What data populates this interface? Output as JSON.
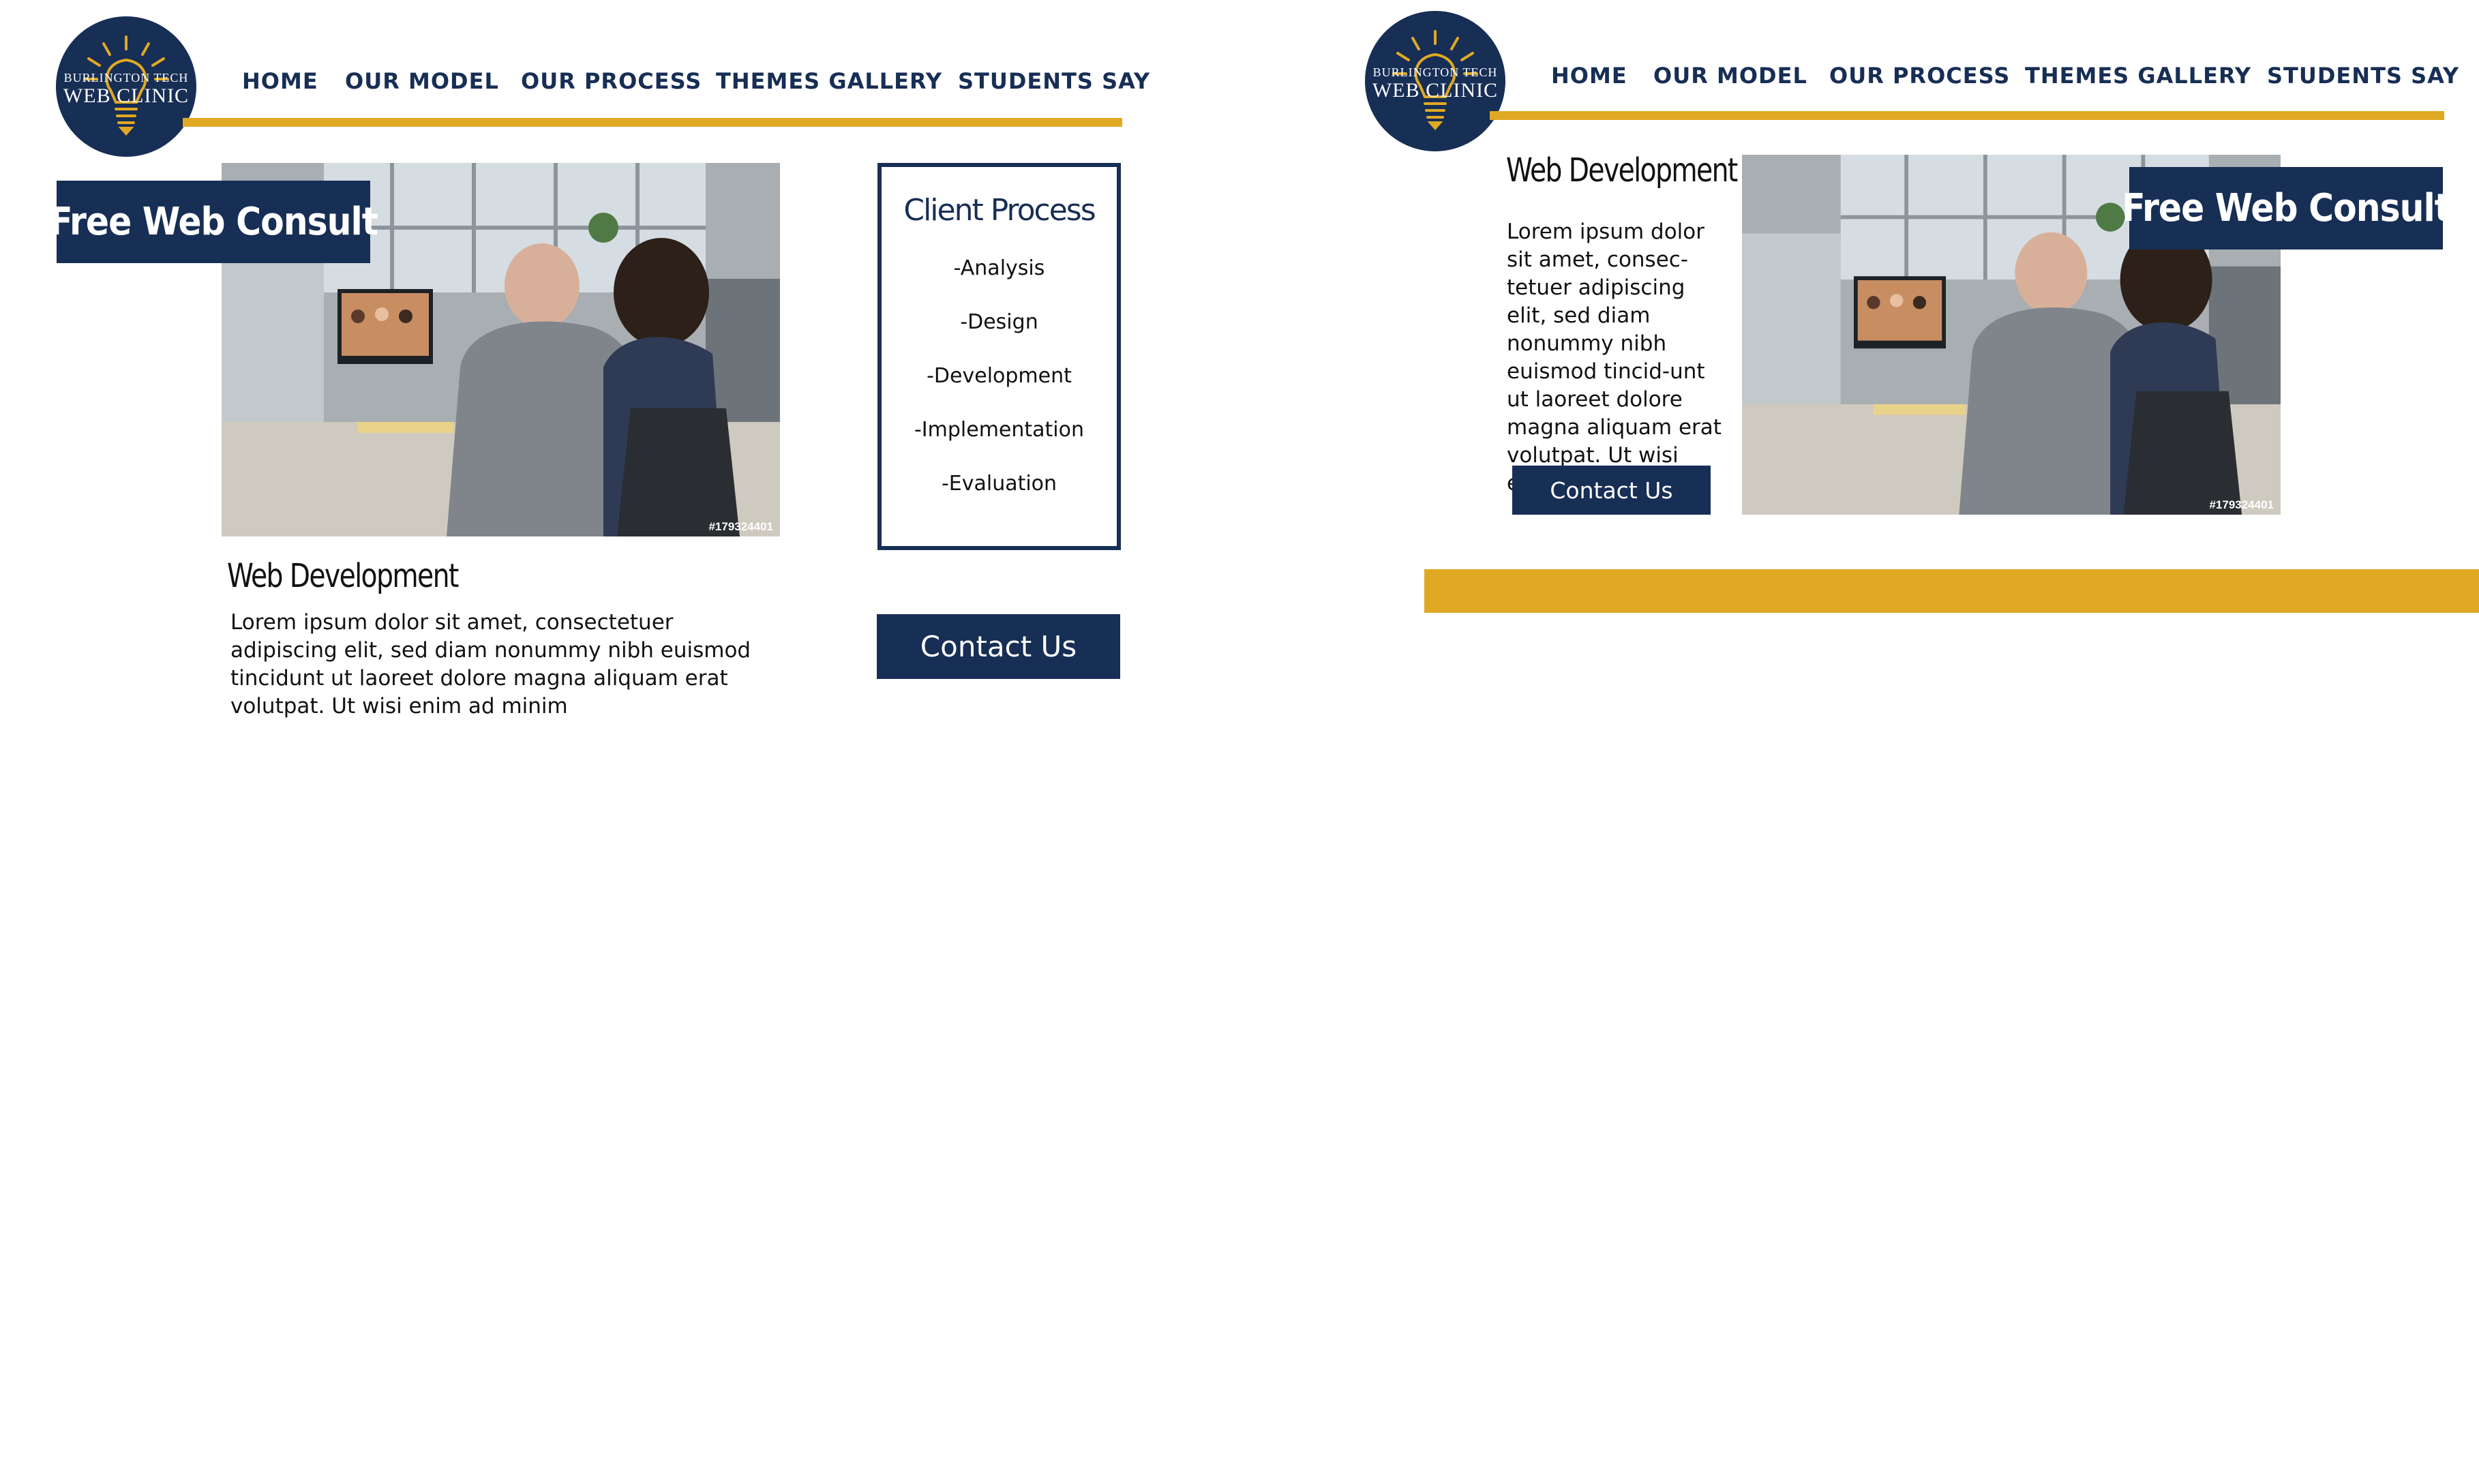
{
  "brand": {
    "logo_line1": "BURLINGTON TECH",
    "logo_line2": "WEB CLINIC",
    "navy": "#172e55",
    "gold": "#e0a924",
    "icon": "lightbulb-icon"
  },
  "nav": {
    "items": [
      "HOME",
      "OUR MODEL",
      "OUR PROCESS",
      "THEMES GALLERY",
      "STUDENTS SAY"
    ]
  },
  "mockup_a": {
    "banner": "Free Web Consult",
    "photo_id": "#179324401",
    "heading": "Web Development",
    "body": "Lorem ipsum dolor sit amet, consectetuer adipiscing elit, sed diam nonummy nibh euismod tincidunt ut laoreet dolore magna aliquam erat volutpat. Ut wisi enim ad minim",
    "process_title": "Client Process",
    "process_steps": [
      "-Analysis",
      "-Design",
      "-Development",
      "-Implementation",
      "-Evaluation"
    ],
    "contact_button": "Contact Us"
  },
  "mockup_b": {
    "banner": "Free Web Consult",
    "photo_id": "#179324401",
    "heading": "Web Development",
    "body": "Lorem ipsum dolor sit amet, consec-tetuer adipiscing elit, sed diam nonummy nibh euismod tincid-unt ut laoreet dolore magna aliquam erat volutpat. Ut wisi enim",
    "contact_button": "Contact Us"
  }
}
